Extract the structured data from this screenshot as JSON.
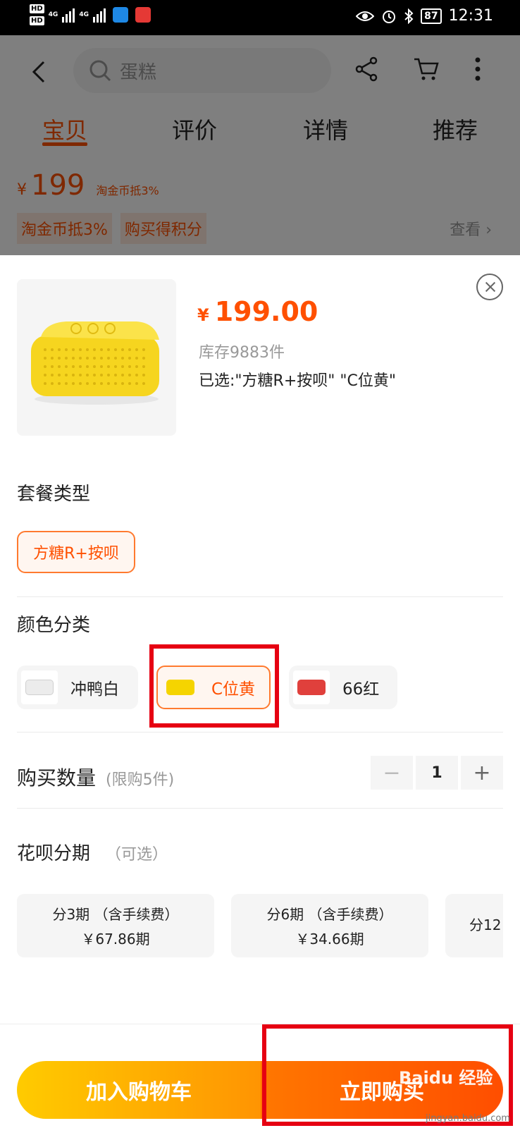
{
  "status_bar": {
    "hd1": "HD",
    "hd2": "HD",
    "net1": "4G",
    "net2": "4G",
    "battery": "87",
    "time": "12:31"
  },
  "background_page": {
    "search_placeholder": "蛋糕",
    "tabs": [
      {
        "label": "宝贝",
        "active": true
      },
      {
        "label": "评价",
        "active": false
      },
      {
        "label": "详情",
        "active": false
      },
      {
        "label": "推荐",
        "active": false
      }
    ],
    "price_currency": "¥",
    "price": "199",
    "price_tag": "淘金币抵3%",
    "promo_tags": [
      "淘金币抵3%",
      "购买得积分"
    ],
    "view_link": "查看"
  },
  "sku_sheet": {
    "currency": "¥",
    "price": "199.00",
    "stock": "库存9883件",
    "selected": "已选:\"方糖R+按呗\" \"C位黄\"",
    "package_section": {
      "title": "套餐类型",
      "options": [
        {
          "label": "方糖R+按呗",
          "selected": true
        }
      ]
    },
    "color_section": {
      "title": "颜色分类",
      "options": [
        {
          "label": "冲鸭白",
          "color": "#ececec",
          "selected": false
        },
        {
          "label": "C位黄",
          "color": "#f5d400",
          "selected": true
        },
        {
          "label": "66红",
          "color": "#e0403c",
          "selected": false
        }
      ]
    },
    "quantity": {
      "label": "购买数量",
      "limit": "(限购5件)",
      "value": "1",
      "minus": "−",
      "plus": "+"
    },
    "installment": {
      "title": "花呗分期",
      "optional": "（可选）",
      "plans": [
        {
          "line1": "分3期 （含手续费）",
          "line2": "￥67.86期"
        },
        {
          "line1": "分6期 （含手续费）",
          "line2": "￥34.66期"
        },
        {
          "line1": "分12",
          "line2": ""
        }
      ]
    }
  },
  "bottom_bar": {
    "add_to_cart": "加入购物车",
    "buy_now": "立即购买",
    "watermark": "Baidu 经验",
    "watermark_url": "jingyan.baidu.com"
  },
  "colors": {
    "accent": "#ff5000",
    "highlight_box": "#e60012"
  }
}
